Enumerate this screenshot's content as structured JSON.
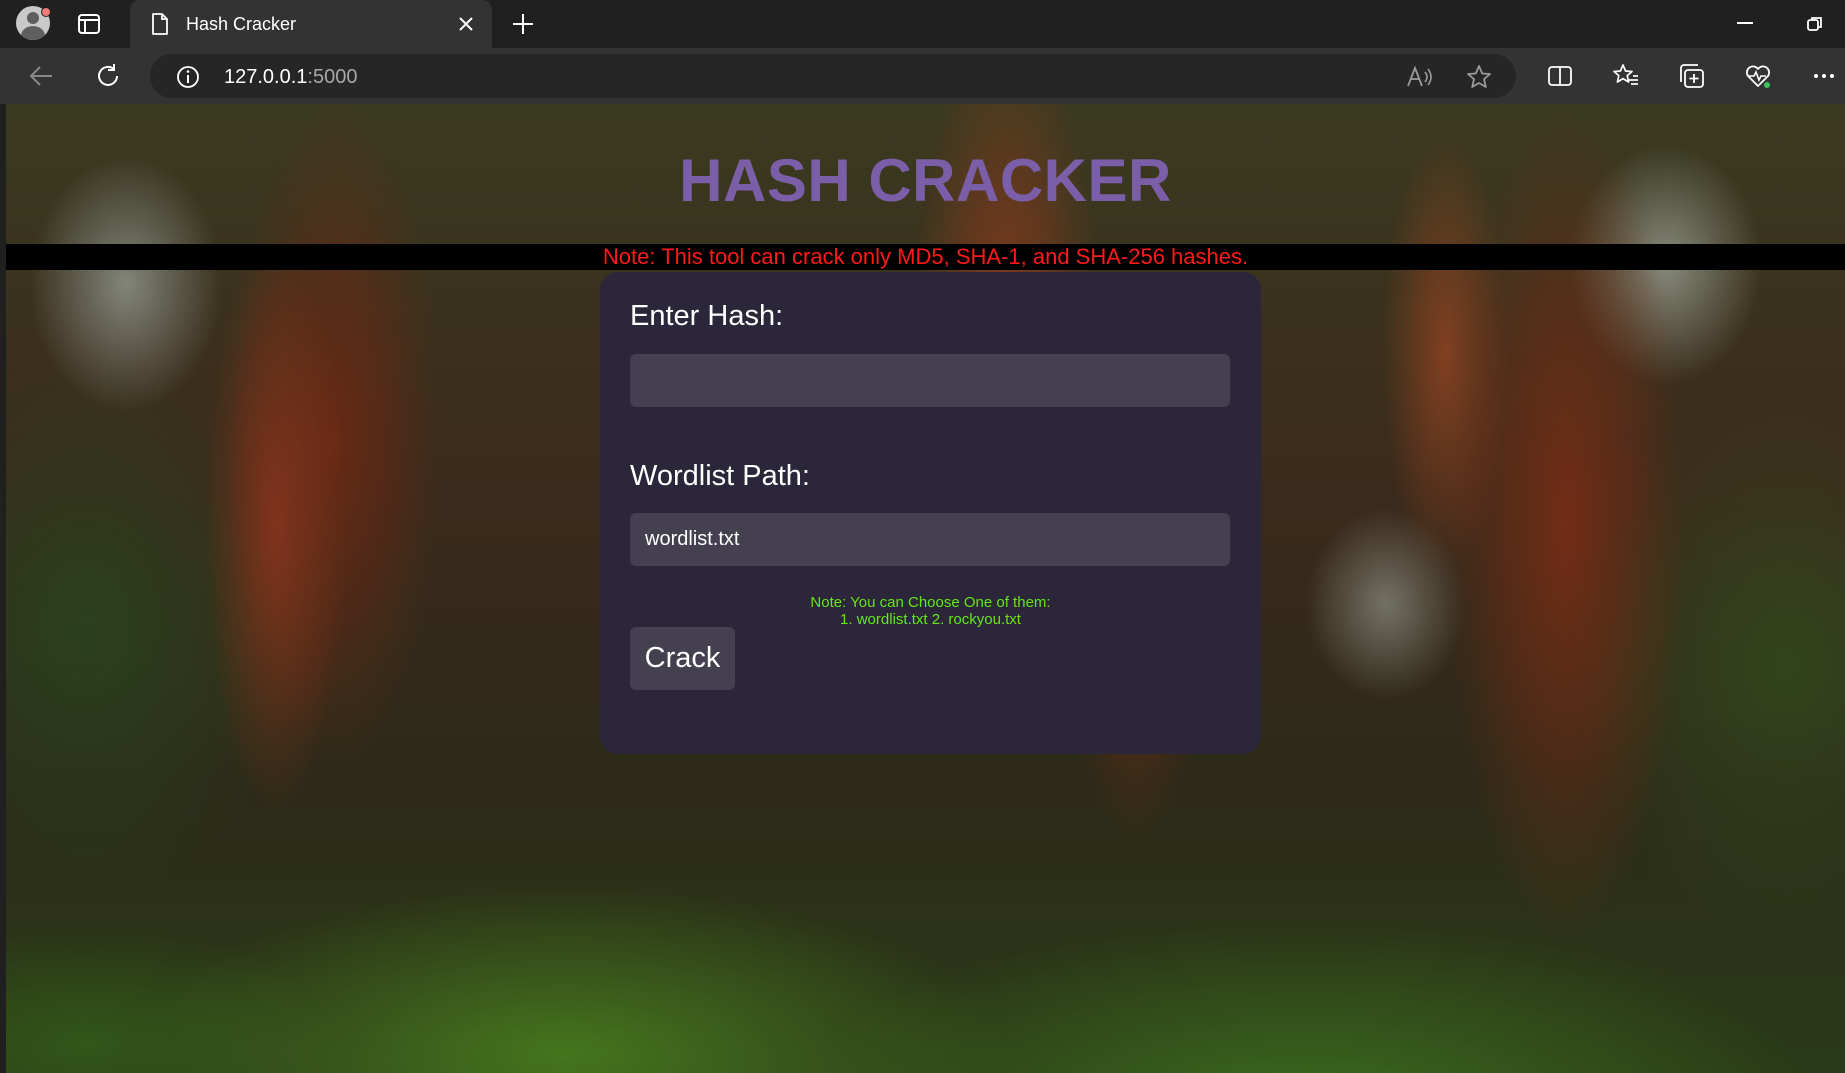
{
  "browser": {
    "tab_title": "Hash Cracker",
    "url_host": "127.0.0.1",
    "url_port": ":5000"
  },
  "page": {
    "title": "HASH CRACKER",
    "notice": "Note: This tool can crack only MD5, SHA-1, and SHA-256 hashes.",
    "hash_label": "Enter Hash:",
    "hash_value": "",
    "wordlist_label": "Wordlist Path:",
    "wordlist_value": "wordlist.txt",
    "hint_line1": "Note: You can Choose One of them:",
    "hint_line2": "1. wordlist.txt 2. rockyou.txt",
    "crack_label": "Crack"
  },
  "colors": {
    "title": "#7b5ea8",
    "notice_text": "#ff1a1a",
    "hint_text": "#66e61a",
    "card_bg": "#2b2639",
    "input_bg": "#45404f"
  }
}
